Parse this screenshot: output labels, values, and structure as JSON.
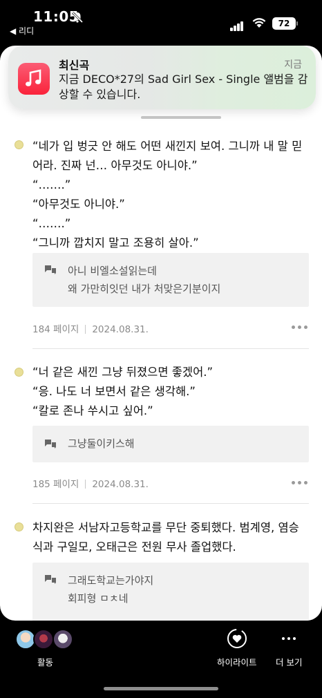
{
  "status_bar": {
    "time": "11:05",
    "back_app": "◀ 리디",
    "battery": "72"
  },
  "notification": {
    "title": "최신곡",
    "time": "지금",
    "body": "지금 DECO*27의 Sad Girl Sex - Single 앨범을 감상할 수 있습니다.",
    "icon": "music-note-icon",
    "icon_color": "#fa233b"
  },
  "highlights": [
    {
      "lines": [
        "“네가 입 벙긋 안 해도 어떤 새낀지 보여. 그니까 내 말 믿",
        "어라. 진짜 넌… 아무것도 아니야.”",
        "“…….”",
        "“아무것도 아니야.”",
        "“…….”",
        "“그니까 깝치지 말고 조용히 살아.”"
      ],
      "memo": [
        "아니 비엘소설읽는데",
        "왜 가만히잇던 내가 처맞은기분이지"
      ],
      "page": "184 페이지",
      "date": "2024.08.31."
    },
    {
      "lines": [
        "“너 같은 새낀 그냥 뒤졌으면 좋겠어.”",
        "“응. 나도 너 보면서 같은 생각해.”",
        "“칼로 존나 쑤시고 싶어.”"
      ],
      "memo": [
        "그냥둘이키스해"
      ],
      "page": "185 페이지",
      "date": "2024.08.31."
    },
    {
      "lines": [
        "차지완은 서남자고등학교를 무단 중퇴했다. 범계영, 염승",
        "식과 구일모, 오태근은 전원 무사 졸업했다."
      ],
      "memo": [
        "그래도학교는가야지",
        "회피형 ㅁㅊ네"
      ]
    }
  ],
  "bottom_bar": {
    "activity_label": "활동",
    "highlight_label": "하이라이트",
    "more_label": "더 보기"
  },
  "colors": {
    "highlight_dot": "#e9df98",
    "memo_bg": "#f1f1f1"
  }
}
